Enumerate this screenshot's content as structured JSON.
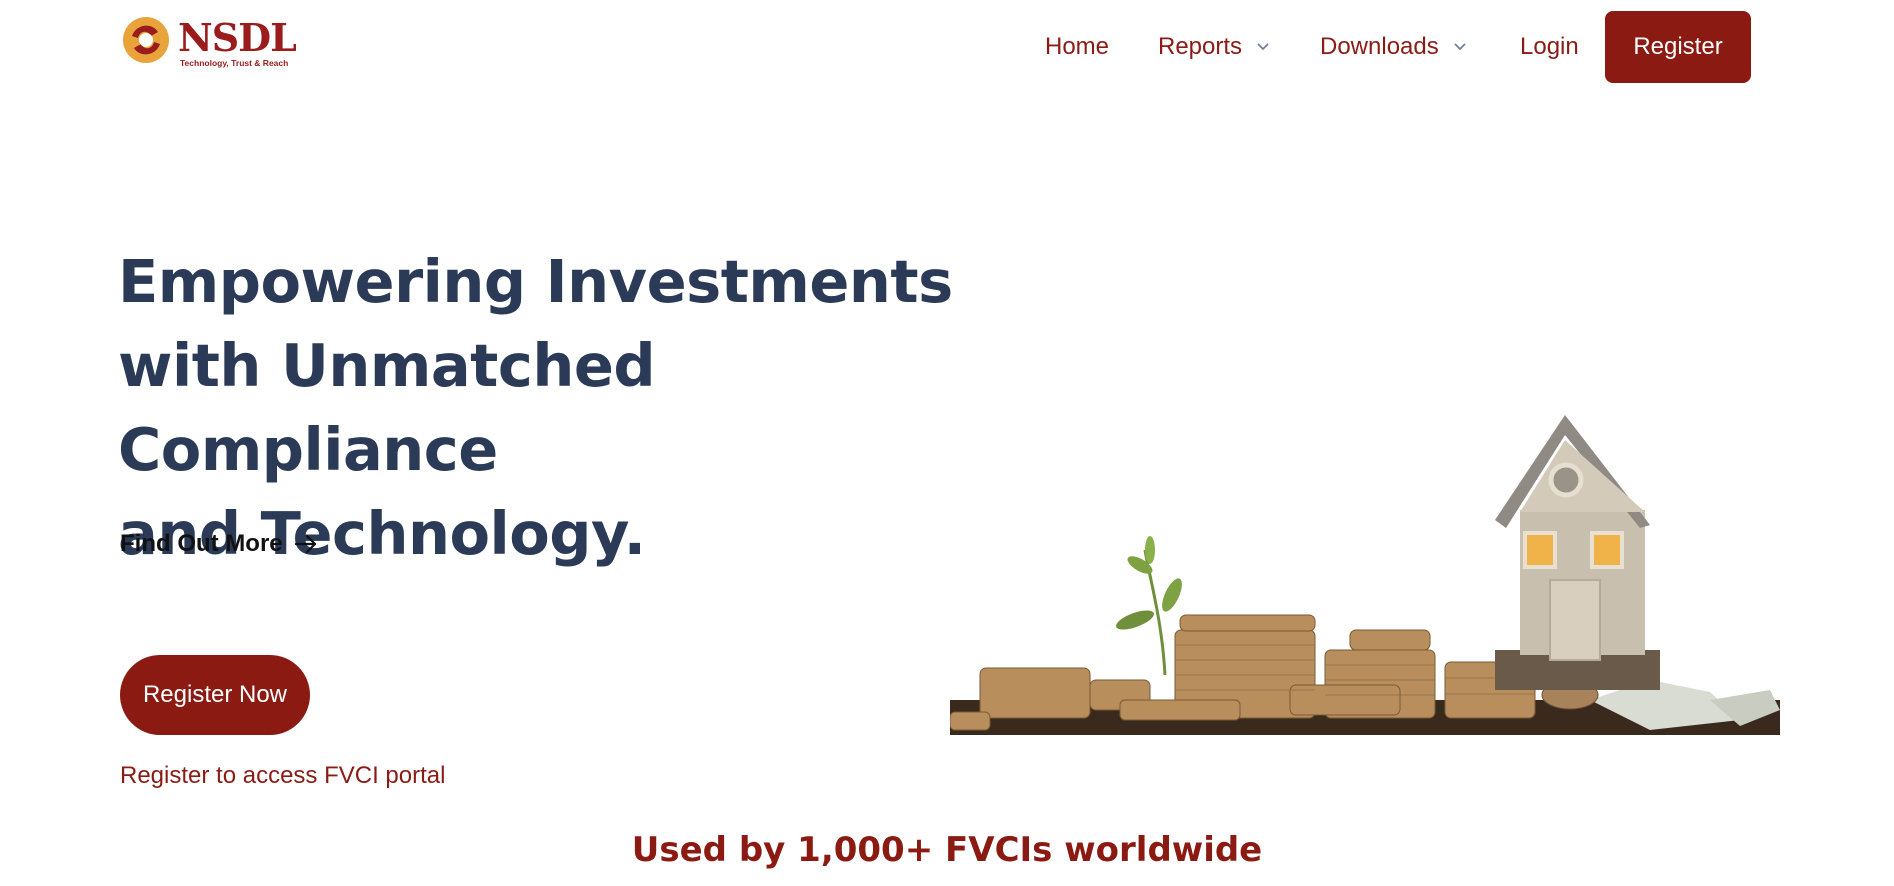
{
  "brand": {
    "name": "NSDL",
    "tagline": "Technology, Trust & Reach",
    "colors": {
      "primary": "#8b1a12",
      "heading": "#2b3a57",
      "logo_orange": "#e8a33a"
    }
  },
  "nav": {
    "items": [
      {
        "label": "Home",
        "dropdown": false
      },
      {
        "label": "Reports",
        "dropdown": true
      },
      {
        "label": "Downloads",
        "dropdown": true
      },
      {
        "label": "Login",
        "dropdown": false
      }
    ],
    "register_label": "Register"
  },
  "hero": {
    "title_lines": [
      "Empowering Investments",
      "with Unmatched Compliance",
      "and Technology."
    ],
    "find_out_more": "Find Out More",
    "register_now": "Register Now",
    "register_sub": "Register to access FVCI portal",
    "illustration": "house-with-coin-stacks-and-plant"
  },
  "stats": {
    "used_by": "Used by 1,000+ FVCIs worldwide"
  }
}
